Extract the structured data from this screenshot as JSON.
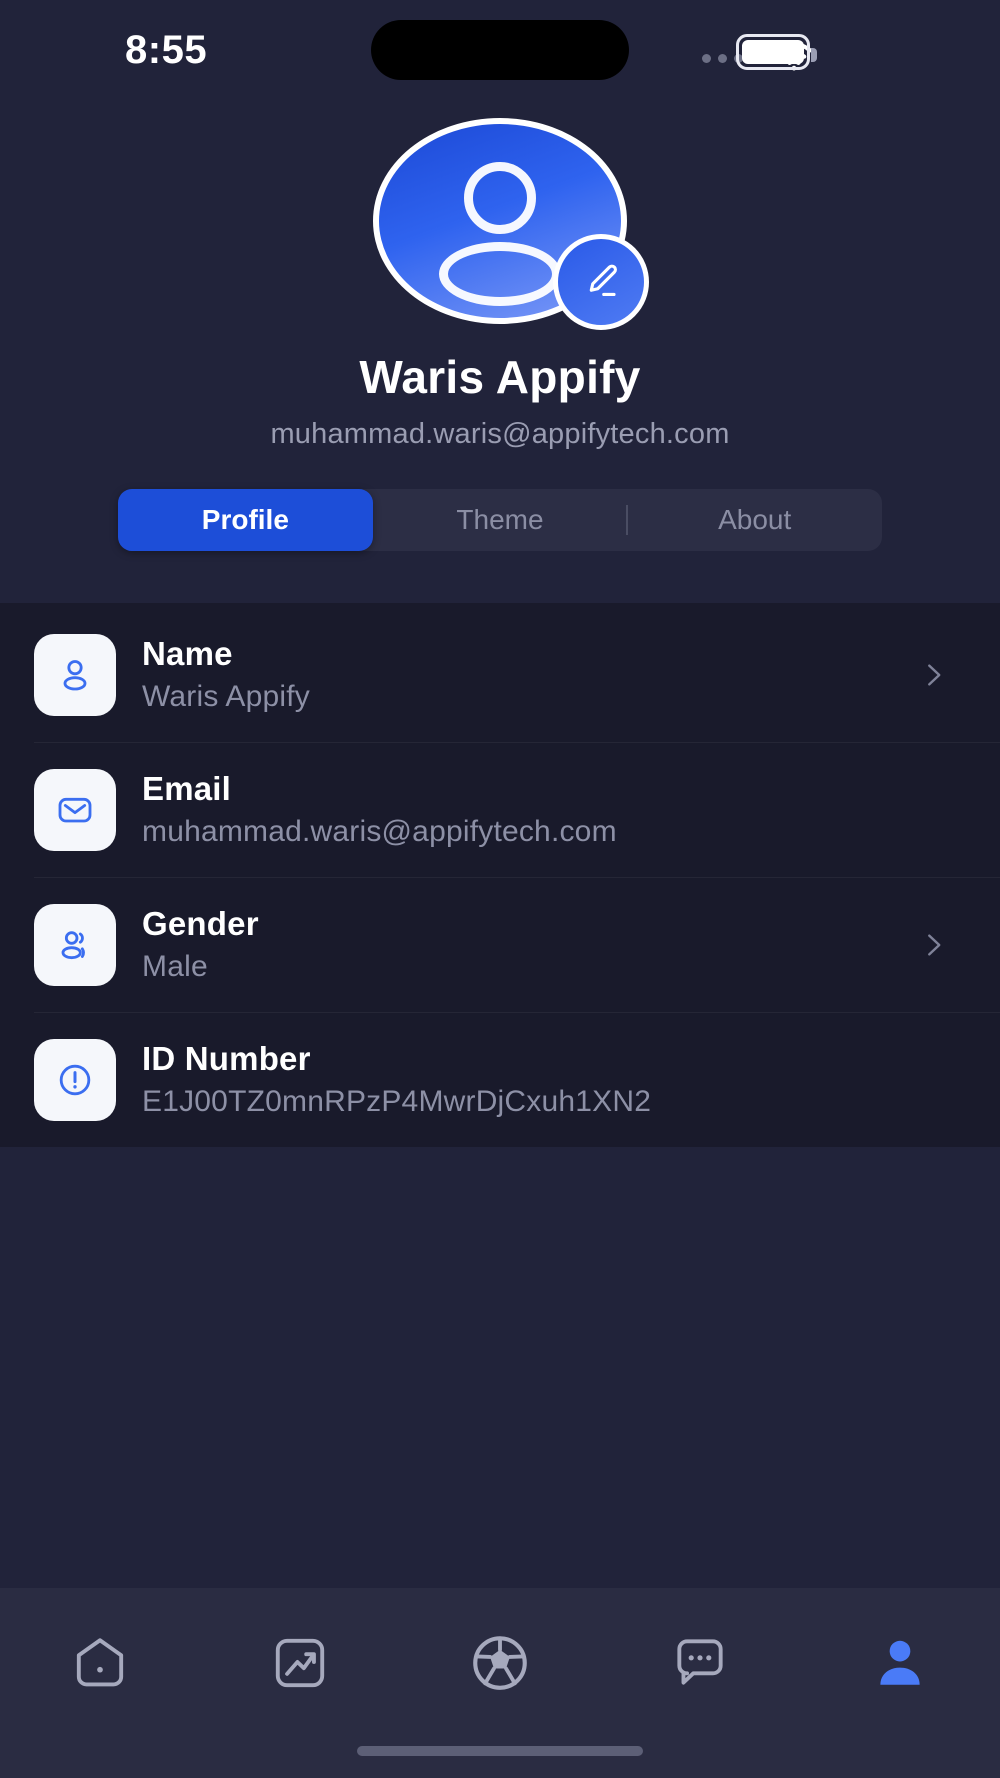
{
  "colors": {
    "page_bg": "#21233a",
    "list_bg": "#191a2b",
    "accent": "#1d4ed8",
    "icon_blue": "#3b6ef0",
    "nav_bg": "#2a2c42",
    "muted_text": "#8d90a6",
    "white": "#ffffff"
  },
  "status_bar": {
    "time": "8:55",
    "signal_icon": "signal-dots-icon",
    "wifi_icon": "wifi-icon",
    "battery_icon": "battery-icon",
    "dynamic_island": "dynamic-island"
  },
  "header": {
    "avatar_icon": "user-avatar-icon",
    "edit_badge_icon": "pencil-edit-icon",
    "name": "Waris Appify",
    "email": "muhammad.waris@appifytech.com"
  },
  "tabs": {
    "active_index": 0,
    "items": [
      {
        "label": "Profile"
      },
      {
        "label": "Theme"
      },
      {
        "label": "About"
      }
    ]
  },
  "profile_rows": [
    {
      "icon": "person-icon",
      "label": "Name",
      "value": "Waris Appify",
      "has_chevron": true
    },
    {
      "icon": "envelope-icon",
      "label": "Email",
      "value": "muhammad.waris@appifytech.com",
      "has_chevron": false
    },
    {
      "icon": "people-group-icon",
      "label": "Gender",
      "value": "Male",
      "has_chevron": true
    },
    {
      "icon": "exclamation-circle-icon",
      "label": "ID Number",
      "value": "E1J00TZ0mnRPzP4MwrDjCxuh1XN2",
      "has_chevron": false
    }
  ],
  "bottom_nav": {
    "active_index": 4,
    "items": [
      {
        "icon": "home-icon"
      },
      {
        "icon": "stats-chart-icon"
      },
      {
        "icon": "soccer-ball-icon"
      },
      {
        "icon": "chat-bubble-icon"
      },
      {
        "icon": "profile-person-icon"
      }
    ],
    "home_indicator": "home-indicator"
  }
}
